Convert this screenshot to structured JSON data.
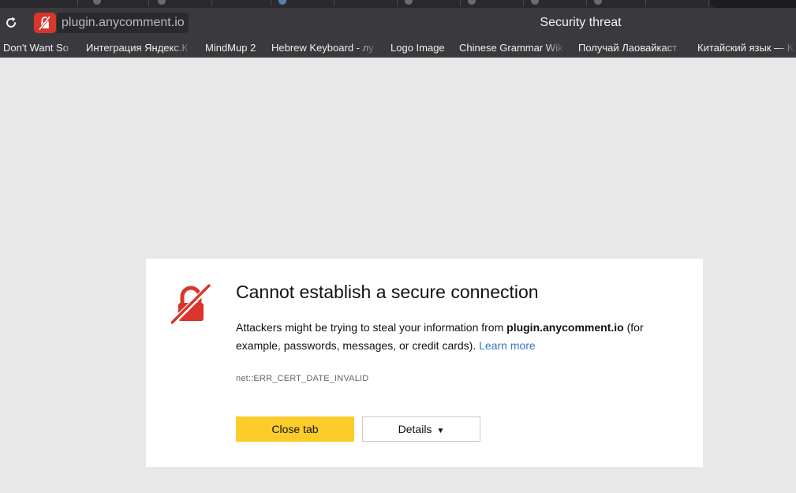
{
  "browser": {
    "url": "plugin.anycomment.io",
    "page_title": "Security threat",
    "icons": {
      "reload": "reload-icon",
      "site_security": "insecure-lock-icon"
    },
    "bookmarks": [
      {
        "label": "Don't Want So"
      },
      {
        "label": "Интеграция Яндекс.К"
      },
      {
        "label": "MindMup 2"
      },
      {
        "label": "Hebrew Keyboard - лу"
      },
      {
        "label": "Logo Image"
      },
      {
        "label": "Chinese Grammar Wik"
      },
      {
        "label": "Получай Лаовайкаст"
      },
      {
        "label": "Китайский язык — K"
      }
    ]
  },
  "error_page": {
    "icon": "broken-lock-icon",
    "title": "Cannot establish a secure connection",
    "message_before": "Attackers might be trying to steal your information from ",
    "host": "plugin.anycomment.io",
    "message_after": " (for example, passwords, messages, or credit cards). ",
    "learn_more": "Learn more",
    "error_code": "net::ERR_CERT_DATE_INVALID",
    "close_button": "Close tab",
    "details_button": "Details",
    "details_caret": "▼"
  },
  "colors": {
    "danger": "#d9352b",
    "primary_button": "#fccd2a",
    "link": "#3b73c6",
    "page_background": "#e8e8e8",
    "toolbar": "#3a3a3e"
  }
}
